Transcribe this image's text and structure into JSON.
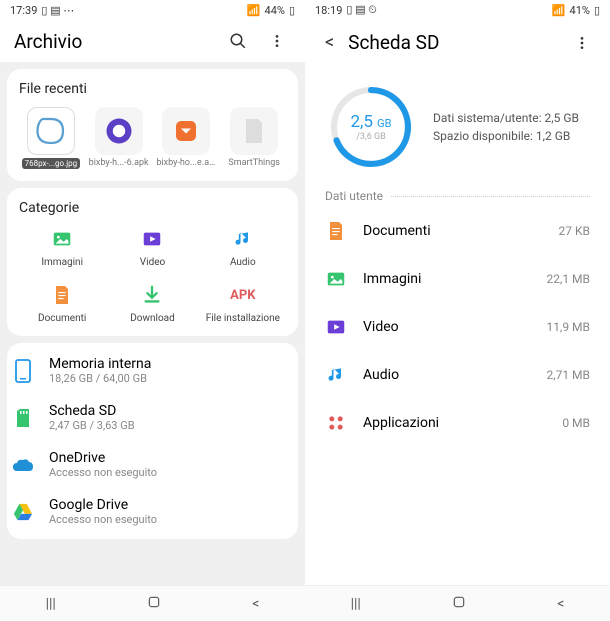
{
  "left": {
    "status": {
      "time": "17:39",
      "battery": "44%"
    },
    "header": {
      "title": "Archivio"
    },
    "recent": {
      "title": "File recenti",
      "items": [
        {
          "label": "768px-...go.jpg",
          "dark": true
        },
        {
          "label": "bixby-h...-6.apk"
        },
        {
          "label": "bixby-ho...e.apk"
        },
        {
          "label": "SmartThings"
        }
      ]
    },
    "categories": {
      "title": "Categorie",
      "items": [
        {
          "label": "Immagini",
          "icon": "image",
          "color": "#36c46f"
        },
        {
          "label": "Video",
          "icon": "video",
          "color": "#6b3fd6"
        },
        {
          "label": "Audio",
          "icon": "audio",
          "color": "#2098e8"
        },
        {
          "label": "Documenti",
          "icon": "doc",
          "color": "#f2903d"
        },
        {
          "label": "Download",
          "icon": "download",
          "color": "#36c46f"
        },
        {
          "label": "File installazione",
          "icon": "apk",
          "color": "#e05b5b"
        }
      ]
    },
    "storage": [
      {
        "name": "Memoria interna",
        "sub": "18,26 GB / 64,00 GB",
        "icon": "phone",
        "color": "#2098e8"
      },
      {
        "name": "Scheda SD",
        "sub": "2,47 GB / 3,63 GB",
        "icon": "sd",
        "color": "#36c46f"
      },
      {
        "name": "OneDrive",
        "sub": "Accesso non eseguito",
        "icon": "onedrive",
        "color": "#1f8fd6"
      },
      {
        "name": "Google Drive",
        "sub": "Accesso non eseguito",
        "icon": "gdrive",
        "color": "#36c46f"
      }
    ]
  },
  "right": {
    "status": {
      "time": "18:19",
      "battery": "41%"
    },
    "header": {
      "title": "Scheda SD"
    },
    "donut": {
      "value": "2,5",
      "unit": "GB",
      "total": "/3,6 GB",
      "info1": "Dati sistema/utente: 2,5 GB",
      "info2": "Spazio disponibile: 1,2 GB",
      "percent": 69
    },
    "userDataLabel": "Dati utente",
    "data": [
      {
        "name": "Documenti",
        "size": "27 KB",
        "icon": "doc",
        "color": "#f2903d"
      },
      {
        "name": "Immagini",
        "size": "22,1 MB",
        "icon": "image",
        "color": "#36c46f"
      },
      {
        "name": "Video",
        "size": "11,9 MB",
        "icon": "video",
        "color": "#6b3fd6"
      },
      {
        "name": "Audio",
        "size": "2,71 MB",
        "icon": "audio",
        "color": "#2098e8"
      },
      {
        "name": "Applicazioni",
        "size": "0 MB",
        "icon": "apps",
        "color": "#e05b5b"
      }
    ]
  }
}
